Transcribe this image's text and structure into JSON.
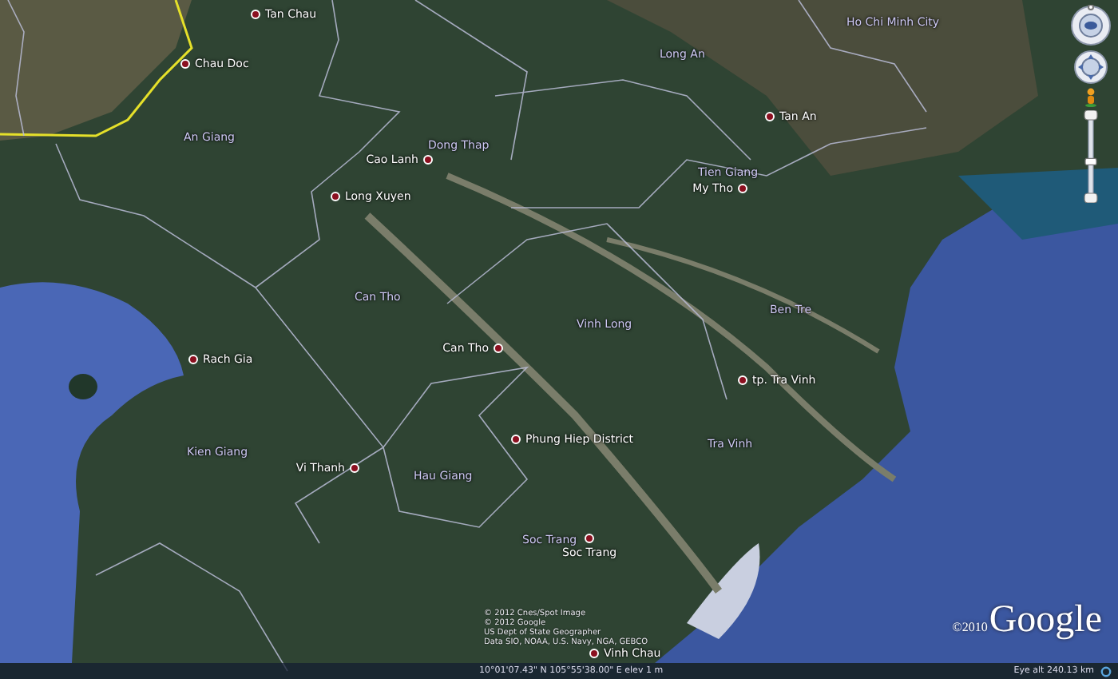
{
  "places": [
    {
      "name": "Tan Chau",
      "kind": "city"
    },
    {
      "name": "Chau Doc",
      "kind": "city"
    },
    {
      "name": "An Giang",
      "kind": "province"
    },
    {
      "name": "Dong Thap",
      "kind": "province"
    },
    {
      "name": "Cao Lanh",
      "kind": "city"
    },
    {
      "name": "Long Xuyen",
      "kind": "city"
    },
    {
      "name": "Long An",
      "kind": "province"
    },
    {
      "name": "Ho Chi Minh City",
      "kind": "province"
    },
    {
      "name": "Tan An",
      "kind": "city"
    },
    {
      "name": "Tien Giang",
      "kind": "province"
    },
    {
      "name": "My Tho",
      "kind": "city"
    },
    {
      "name": "Can Tho",
      "kind": "province"
    },
    {
      "name": "Vinh Long",
      "kind": "province"
    },
    {
      "name": "Ben Tre",
      "kind": "province"
    },
    {
      "name": "Can Tho",
      "kind": "city"
    },
    {
      "name": "Rach Gia",
      "kind": "city"
    },
    {
      "name": "tp. Tra Vinh",
      "kind": "city"
    },
    {
      "name": "Phung Hiep District",
      "kind": "city"
    },
    {
      "name": "Tra Vinh",
      "kind": "province"
    },
    {
      "name": "Kien Giang",
      "kind": "province"
    },
    {
      "name": "Vi Thanh",
      "kind": "city"
    },
    {
      "name": "Hau Giang",
      "kind": "province"
    },
    {
      "name": "Soc Trang",
      "kind": "province"
    },
    {
      "name": "Soc Trang",
      "kind": "city"
    },
    {
      "name": "Vinh Chau",
      "kind": "city"
    }
  ],
  "attribution": [
    "© 2012 Cnes/Spot Image",
    "© 2012 Google",
    "US Dept of State Geographer",
    "Data SIO, NOAA, U.S. Navy, NGA, GEBCO"
  ],
  "zoom_slider": {
    "level": 0.45
  },
  "logo": {
    "copyright": "©2010",
    "name": "Google"
  },
  "status_bar": {
    "coordinates": "10°01'07.43\" N 105°55'38.00\" E elev 1 m",
    "eye_alt": "Eye alt 240.13 km"
  }
}
